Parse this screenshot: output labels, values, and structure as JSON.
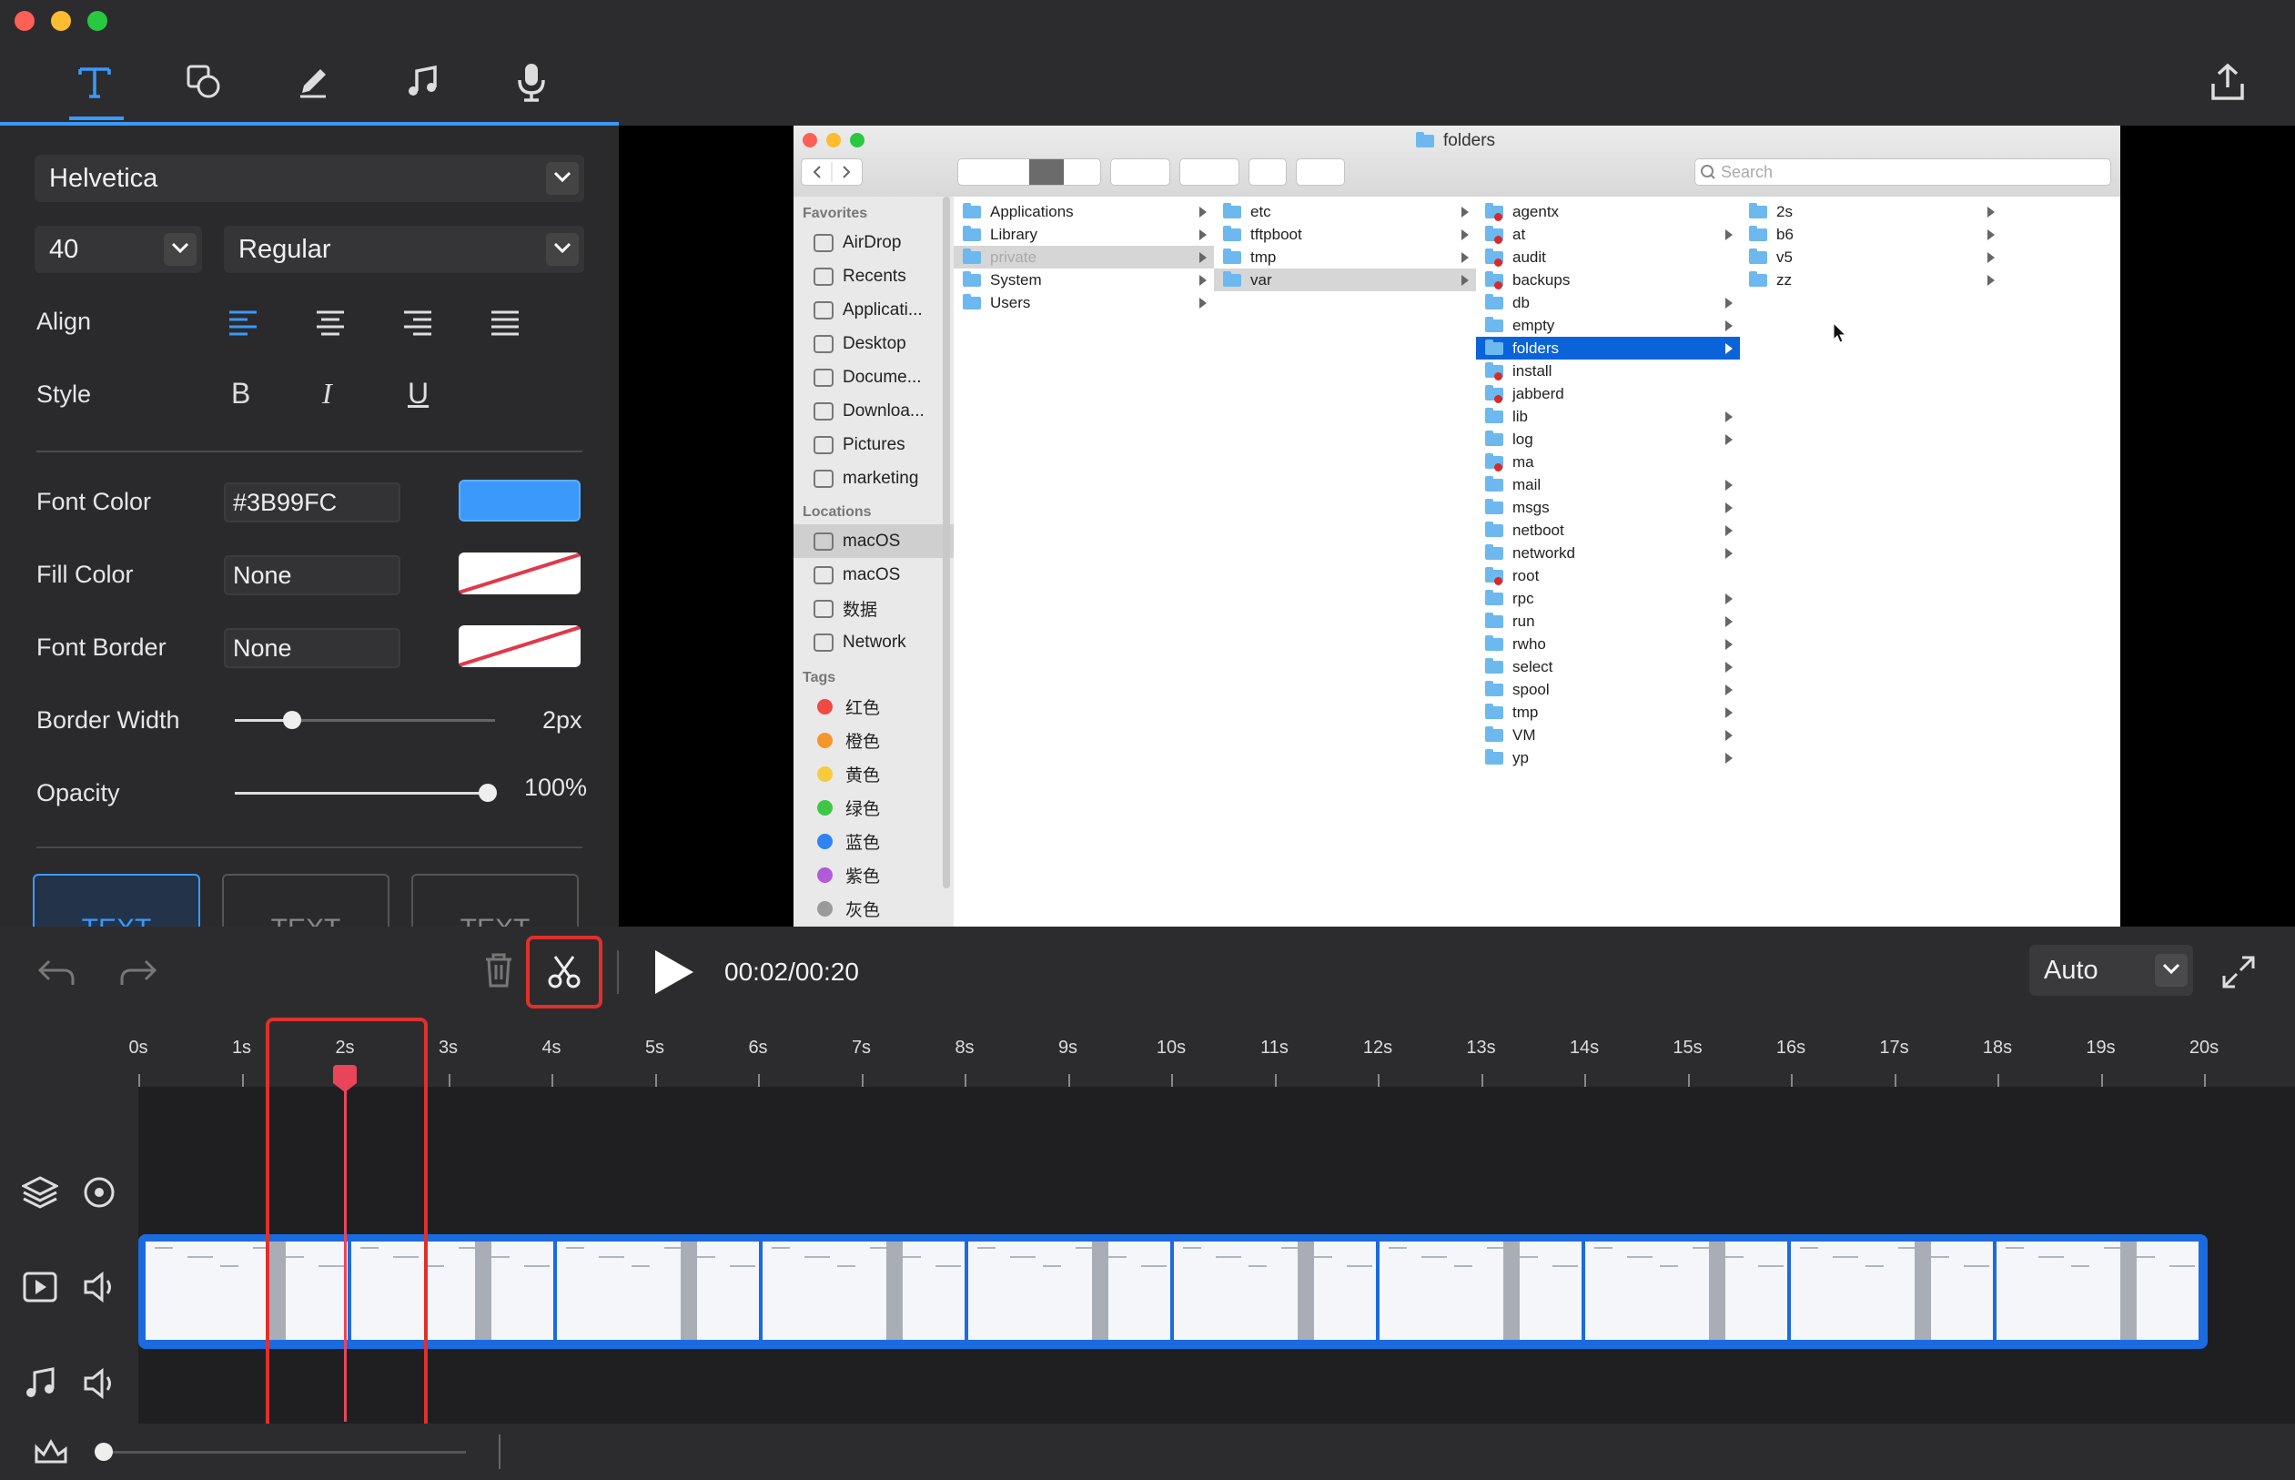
{
  "window": {
    "title_bar_colors": {
      "close": "#fe5f57",
      "minimize": "#febc2e",
      "zoom": "#28c840"
    }
  },
  "toolbar": {
    "tools": [
      "text-icon",
      "shape-icon",
      "pen-icon",
      "music-icon",
      "microphone-icon"
    ],
    "active_tool": "text-icon",
    "export_icon": "share-icon"
  },
  "text_panel": {
    "font_family": "Helvetica",
    "font_size": "40",
    "font_weight": "Regular",
    "align_label": "Align",
    "style_label": "Style",
    "style_bold": "B",
    "style_italic": "I",
    "style_underline": "U",
    "font_color_label": "Font Color",
    "font_color_value": "#3B99FC",
    "fill_color_label": "Fill Color",
    "fill_color_value": "None",
    "font_border_label": "Font Border",
    "font_border_value": "None",
    "border_width_label": "Border Width",
    "border_width_value": "2px",
    "border_width_fraction": 0.22,
    "opacity_label": "Opacity",
    "opacity_value": "100%",
    "opacity_fraction": 1.0,
    "presets": [
      "TEXT",
      "TEXT",
      "TEXT"
    ],
    "accent": "#3b99fc"
  },
  "finder": {
    "title": "folders",
    "search_placeholder": "Search",
    "sidebar": {
      "favorites_header": "Favorites",
      "favorites": [
        "AirDrop",
        "Recents",
        "Applicati...",
        "Desktop",
        "Docume...",
        "Downloa...",
        "Pictures",
        "marketing"
      ],
      "locations_header": "Locations",
      "locations": [
        "macOS",
        "macOS",
        "数据",
        "Network"
      ],
      "tags_header": "Tags",
      "tags": [
        {
          "name": "红色",
          "color": "#f04a45"
        },
        {
          "name": "橙色",
          "color": "#f5962d"
        },
        {
          "name": "黄色",
          "color": "#f7cb3c"
        },
        {
          "name": "绿色",
          "color": "#3ec746"
        },
        {
          "name": "蓝色",
          "color": "#2f84f0"
        },
        {
          "name": "紫色",
          "color": "#b05cd8"
        },
        {
          "name": "灰色",
          "color": "#9a9a9a"
        }
      ]
    },
    "column1": [
      "Applications",
      "Library",
      "private",
      "System",
      "Users"
    ],
    "column2": [
      "etc",
      "tftpboot",
      "tmp",
      "var"
    ],
    "column3": [
      "agentx",
      "at",
      "audit",
      "backups",
      "db",
      "empty",
      "folders",
      "install",
      "jabberd",
      "lib",
      "log",
      "ma",
      "mail",
      "msgs",
      "netboot",
      "networkd",
      "root",
      "rpc",
      "run",
      "rwho",
      "select",
      "spool",
      "tmp",
      "VM",
      "yp"
    ],
    "column4": [
      "2s",
      "b6",
      "v5",
      "zz"
    ]
  },
  "transport": {
    "time": "00:02/00:20",
    "zoom_option": "Auto"
  },
  "timeline": {
    "ticks": [
      "0s",
      "1s",
      "2s",
      "3s",
      "4s",
      "5s",
      "6s",
      "7s",
      "8s",
      "9s",
      "10s",
      "11s",
      "12s",
      "13s",
      "14s",
      "15s",
      "16s",
      "17s",
      "18s",
      "19s",
      "20s"
    ],
    "playhead_seconds": 2,
    "duration_seconds": 20,
    "highlight_color": "#e0302b",
    "playhead_color": "#e8455a"
  }
}
